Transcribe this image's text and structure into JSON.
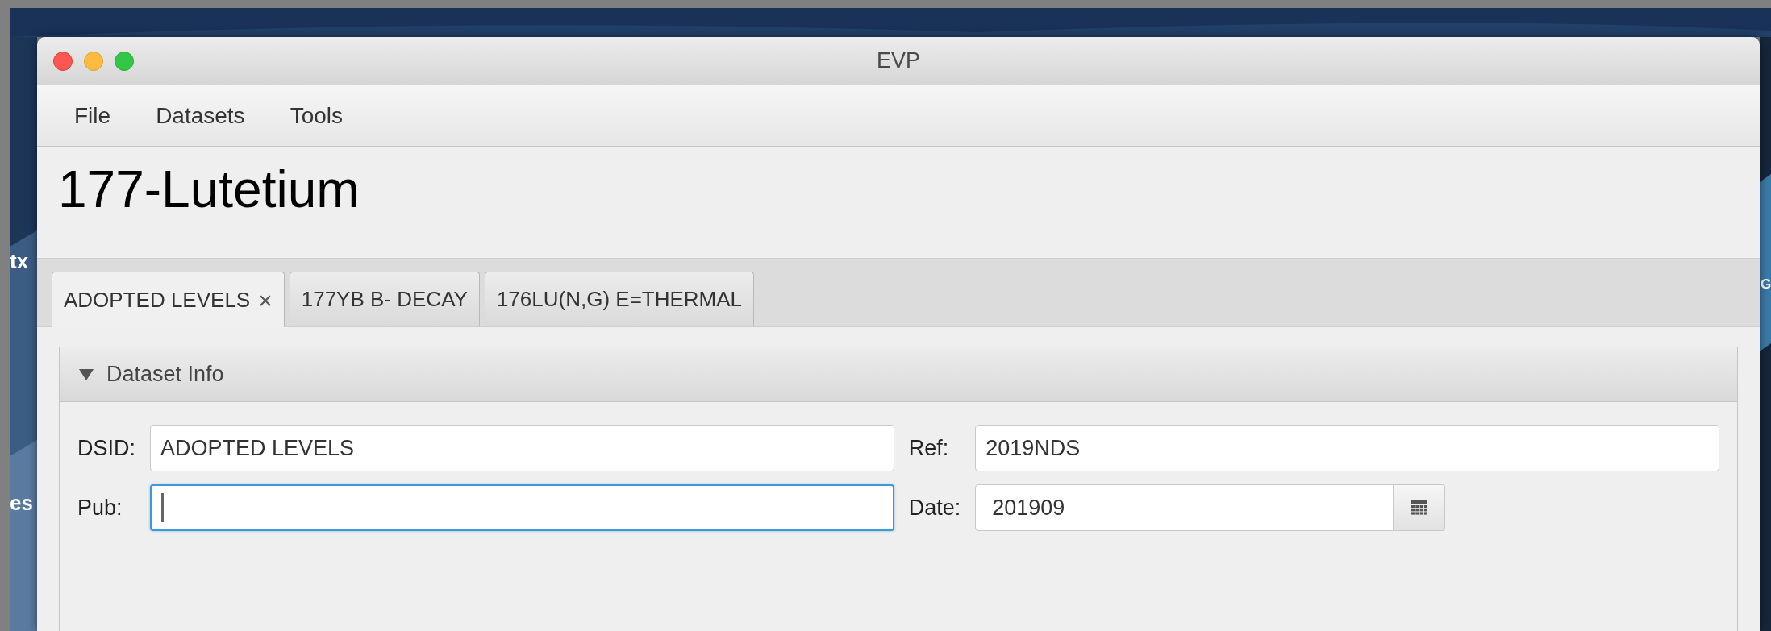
{
  "desktop": {
    "left_labels": [
      "tx",
      "es"
    ],
    "right_labels": [
      "G"
    ]
  },
  "window": {
    "title": "EVP"
  },
  "menu": [
    "File",
    "Datasets",
    "Tools"
  ],
  "heading": "177-Lutetium",
  "tabs": [
    {
      "label": "ADOPTED LEVELS",
      "close": "×",
      "selected": true
    },
    {
      "label": "177YB B- DECAY",
      "selected": false
    },
    {
      "label": "176LU(N,G) E=THERMAL",
      "selected": false
    }
  ],
  "section": {
    "title": "Dataset Info",
    "expanded": true,
    "fields": [
      {
        "label": "DSID:",
        "value": "ADOPTED LEVELS",
        "kind": "text",
        "focused": false
      },
      {
        "label": "Ref:",
        "value": "2019NDS",
        "kind": "text",
        "focused": false
      },
      {
        "label": "Pub:",
        "kind": "text",
        "focused": true
      },
      {
        "label": "Date:",
        "value": "201909",
        "kind": "date",
        "focused": false
      }
    ]
  }
}
